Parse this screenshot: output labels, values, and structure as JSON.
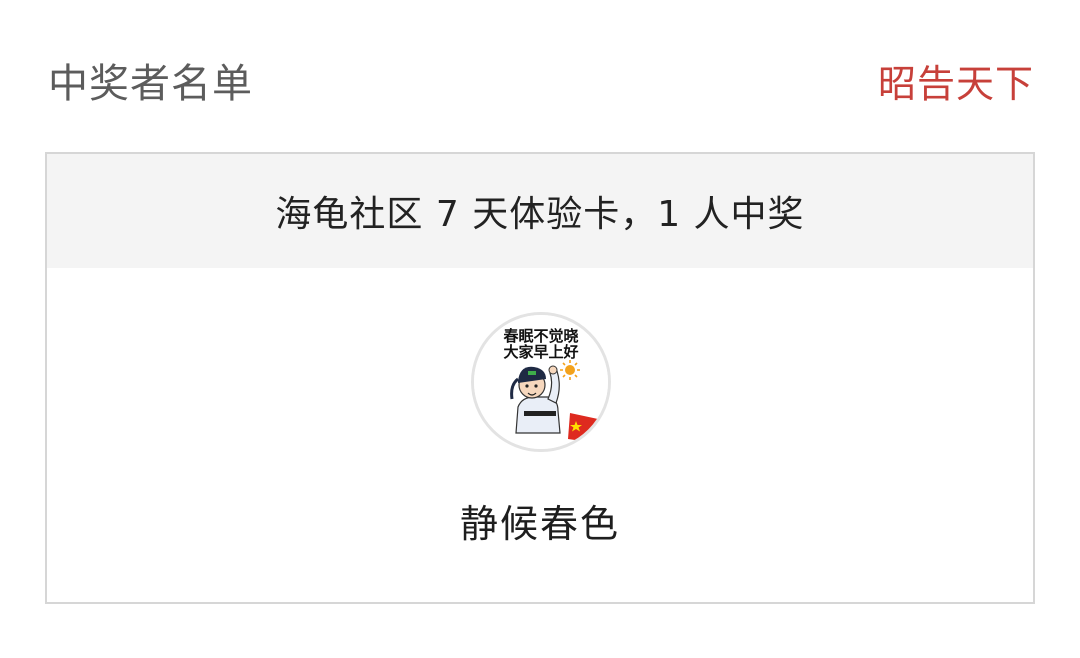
{
  "header": {
    "title": "中奖者名单",
    "action_label": "昭告天下",
    "action_color": "#c7403a"
  },
  "prize_card": {
    "summary": "海龟社区 7 天体验卡，1 人中奖",
    "winners": [
      {
        "name": "静候春色",
        "avatar": {
          "caption_line1": "春眠不觉晓",
          "caption_line2": "大家早上好",
          "icon": "cartoon-scholar-waving-avatar"
        }
      }
    ]
  }
}
